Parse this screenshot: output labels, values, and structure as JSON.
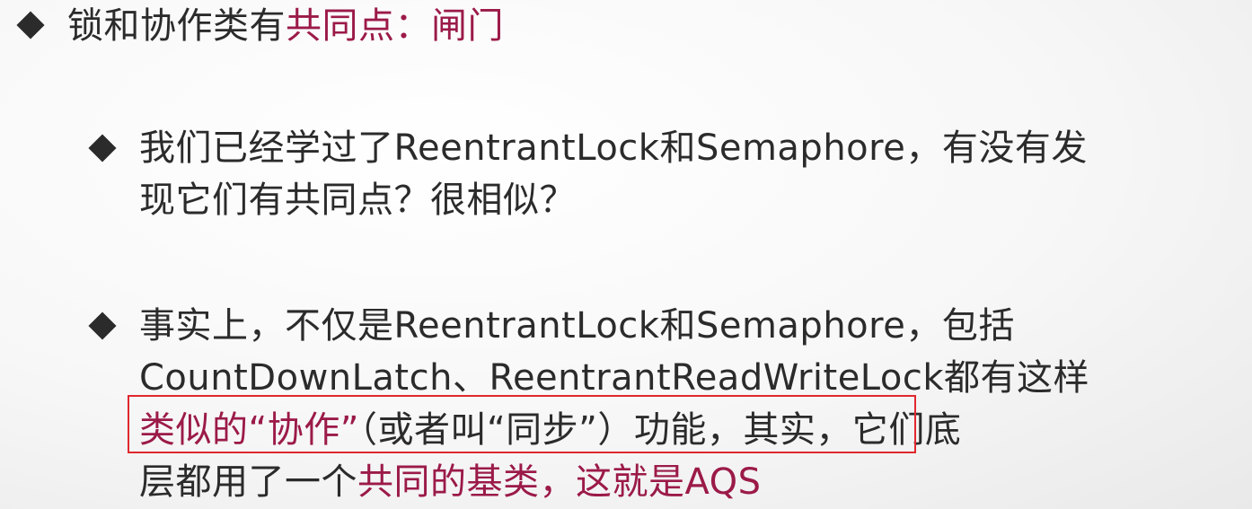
{
  "bullets": [
    {
      "parts": [
        "锁和协作类有",
        "共同点",
        "：",
        "闸门"
      ]
    },
    {
      "line1": "我们已经学过了ReentrantLock和Semaphore，有没有发",
      "line2": "现它们有共同点？很相似？"
    },
    {
      "line1": "事实上，不仅是ReentrantLock和Semaphore，包括",
      "line2": "CountDownLatch、ReentrantReadWriteLock都有这样",
      "line3_highlight": "类似的“协作”",
      "line3_rest": "（或者叫“同步”）功能",
      "line3_tail": "，其实，它们底",
      "line4_plain": "层都用了一个",
      "line4_accent": "共同的基类，这就是AQS"
    }
  ],
  "colors": {
    "text": "#2b2b2b",
    "accent": "#9b1a48",
    "highlight_border": "#e0282e"
  }
}
